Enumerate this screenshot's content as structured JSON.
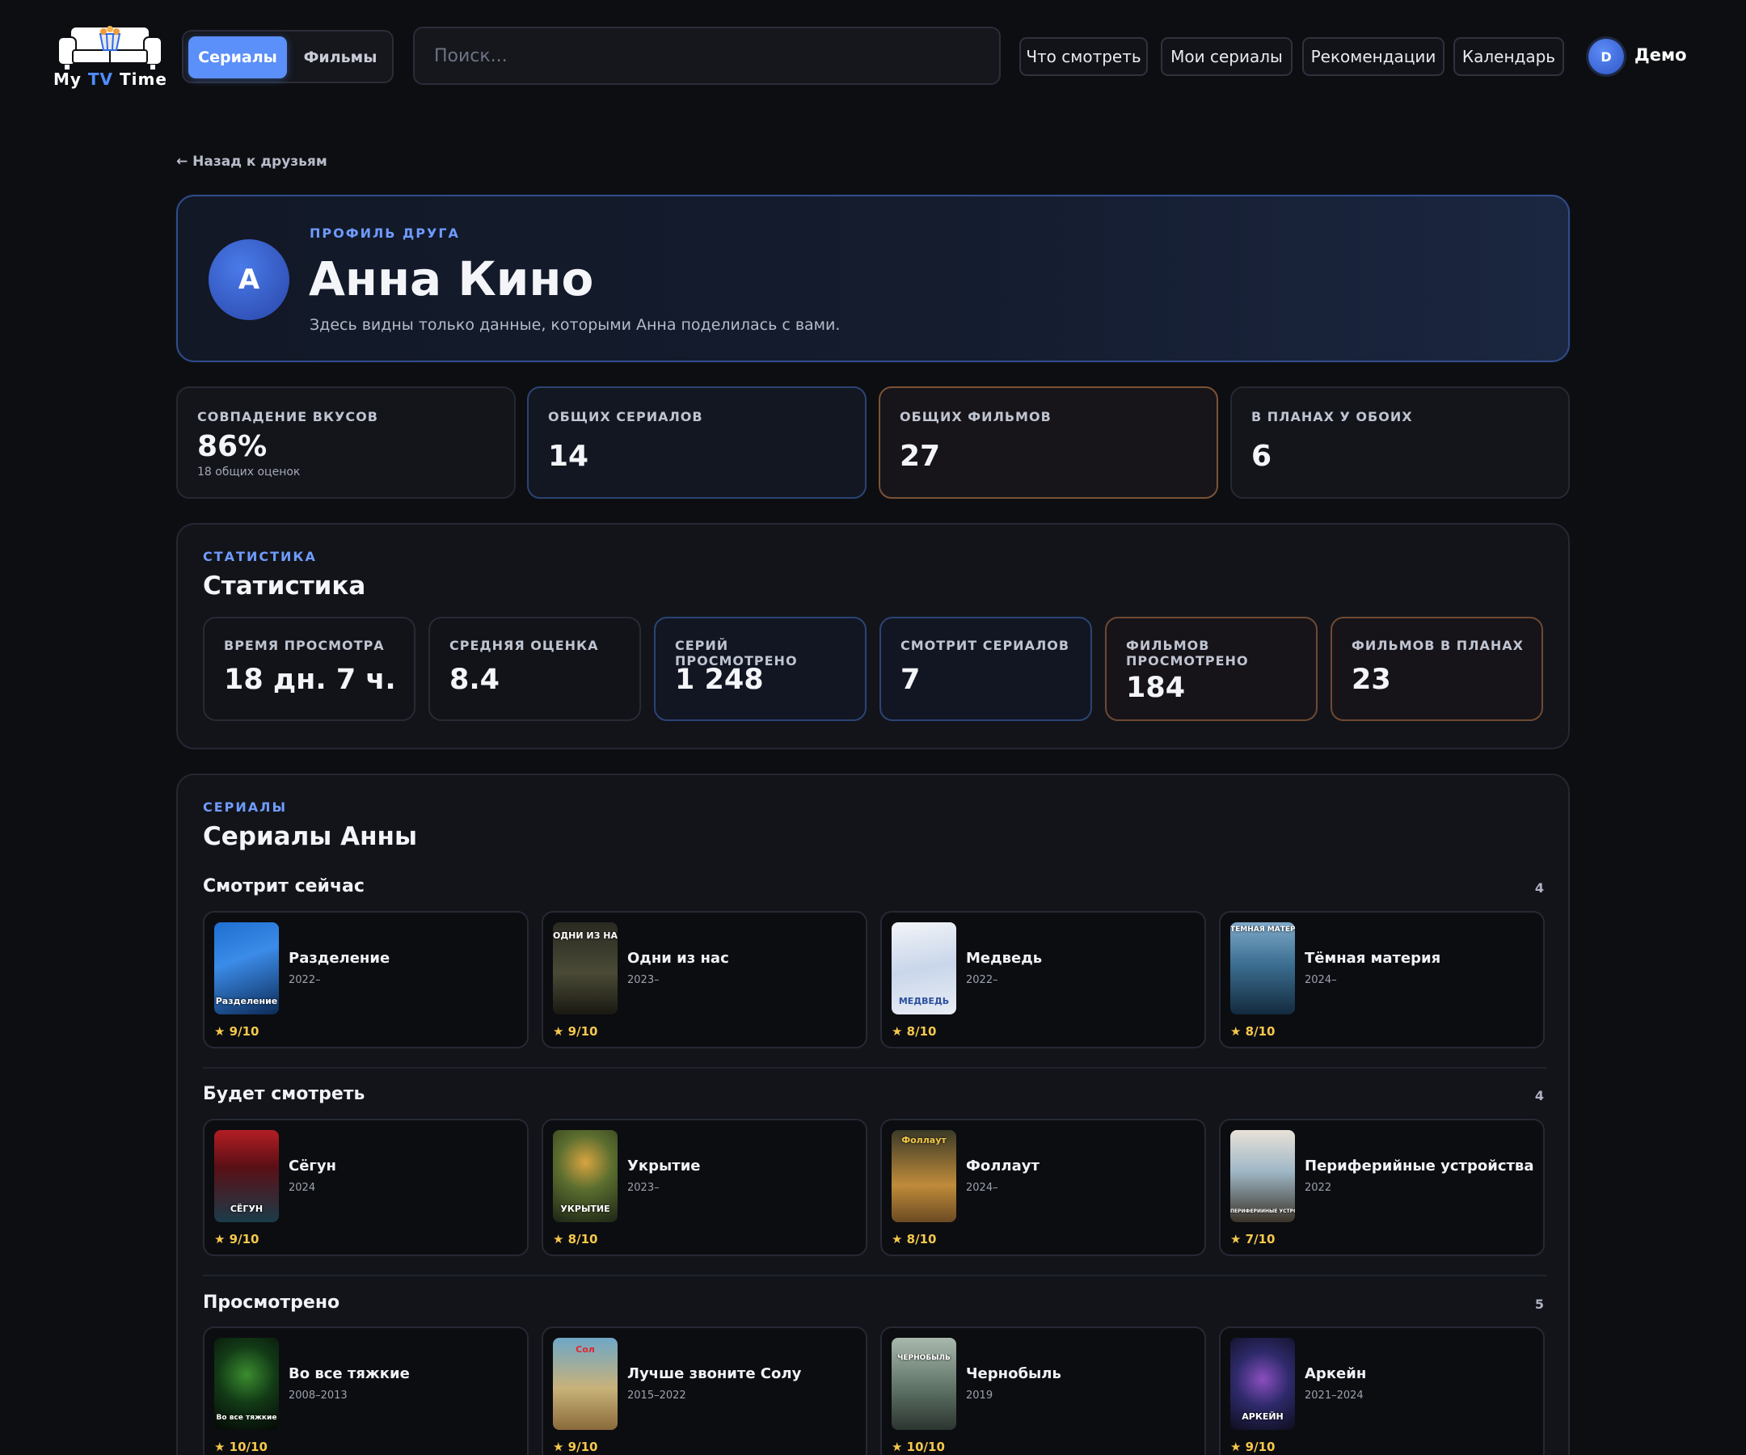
{
  "header": {
    "logo_text_pre": "My ",
    "logo_text_tv": "TV",
    "logo_text_post": " Time",
    "mode_tabs": [
      "Сериалы",
      "Фильмы"
    ],
    "search_placeholder": "Поиск...",
    "nav": [
      "Что смотреть",
      "Мои сериалы",
      "Рекомендации",
      "Календарь"
    ],
    "user_initial": "D",
    "user_name": "Демо"
  },
  "back_link": "← Назад к друзьям",
  "profile": {
    "kicker": "ПРОФИЛЬ ДРУГА",
    "initial": "A",
    "name": "Анна Кино",
    "note": "Здесь видны только данные, которыми Анна поделилась с вами."
  },
  "summary": [
    {
      "label": "СОВПАДЕНИЕ ВКУСОВ",
      "value": "86%",
      "sub": "18 общих оценок"
    },
    {
      "label": "ОБЩИХ СЕРИАЛОВ",
      "value": "14"
    },
    {
      "label": "ОБЩИХ ФИЛЬМОВ",
      "value": "27"
    },
    {
      "label": "В ПЛАНАХ У ОБОИХ",
      "value": "6"
    }
  ],
  "stats": {
    "kicker": "СТАТИСТИКА",
    "title": "Статистика",
    "items": [
      {
        "label": "ВРЕМЯ ПРОСМОТРА",
        "value": "18 дн. 7 ч."
      },
      {
        "label": "СРЕДНЯЯ ОЦЕНКА",
        "value": "8.4"
      },
      {
        "label": "СЕРИЙ ПРОСМОТРЕНО",
        "value": "1 248"
      },
      {
        "label": "СМОТРИТ СЕРИАЛОВ",
        "value": "7"
      },
      {
        "label": "ФИЛЬМОВ ПРОСМОТРЕНО",
        "value": "184"
      },
      {
        "label": "ФИЛЬМОВ В ПЛАНАХ",
        "value": "23"
      }
    ]
  },
  "shows": {
    "kicker": "СЕРИАЛЫ",
    "title": "Сериалы Анны",
    "groups": [
      {
        "title": "Смотрит сейчас",
        "count": "4",
        "items": [
          {
            "name": "Разделение",
            "years": "2022–",
            "rating": "★ 9/10",
            "poster_text": "Разделение"
          },
          {
            "name": "Одни из нас",
            "years": "2023–",
            "rating": "★ 9/10",
            "poster_text": "ОДНИ ИЗ НАС"
          },
          {
            "name": "Медведь",
            "years": "2022–",
            "rating": "★ 8/10",
            "poster_text": "МЕДВЕДЬ"
          },
          {
            "name": "Тёмная материя",
            "years": "2024–",
            "rating": "★ 8/10",
            "poster_text": "ТЁМНАЯ МАТЕРИЯ"
          }
        ]
      },
      {
        "title": "Будет смотреть",
        "count": "4",
        "items": [
          {
            "name": "Сёгун",
            "years": "2024",
            "rating": "★ 9/10",
            "poster_text": "СЁГУН"
          },
          {
            "name": "Укрытие",
            "years": "2023–",
            "rating": "★ 8/10",
            "poster_text": "УКРЫТИЕ"
          },
          {
            "name": "Фоллаут",
            "years": "2024–",
            "rating": "★ 8/10",
            "poster_text": "Фоллаут"
          },
          {
            "name": "Периферийные устройства",
            "years": "2022",
            "rating": "★ 7/10",
            "poster_text": "ПЕРИФЕРИЙНЫЕ УСТРОЙСТВА"
          }
        ]
      },
      {
        "title": "Просмотрено",
        "count": "5",
        "items": [
          {
            "name": "Во все тяжкие",
            "years": "2008–2013",
            "rating": "★ 10/10",
            "poster_text": "Во все тяжкие"
          },
          {
            "name": "Лучше звоните Солу",
            "years": "2015–2022",
            "rating": "★ 9/10",
            "poster_text": "Сол"
          },
          {
            "name": "Чернобыль",
            "years": "2019",
            "rating": "★ 10/10",
            "poster_text": "ЧЕРНОБЫЛЬ"
          },
          {
            "name": "Аркейн",
            "years": "2021–2024",
            "rating": "★ 9/10",
            "poster_text": "АРКЕЙН"
          }
        ]
      }
    ]
  },
  "colors": {
    "accent": "#5b8ff9",
    "kicker": "#6f9bff",
    "rating": "#f5c84c",
    "card_orange_border": "#7a5236"
  }
}
